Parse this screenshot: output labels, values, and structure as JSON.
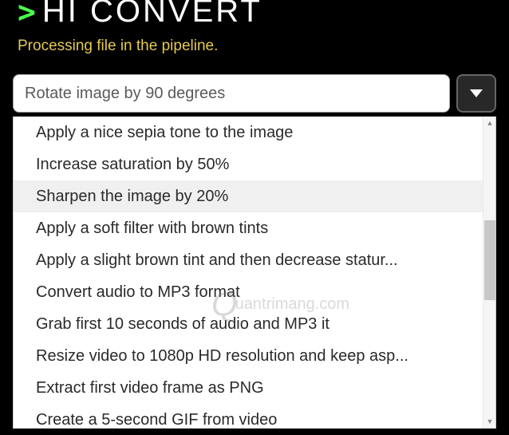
{
  "header": {
    "logo_arrow": ">",
    "logo_text": "HI CONVERT",
    "subtitle": "Processing file in the pipeline."
  },
  "select": {
    "value": "Rotate image by 90 degrees"
  },
  "dropdown": {
    "items": [
      {
        "label": "Apply a nice sepia tone to the image",
        "highlighted": false
      },
      {
        "label": "Increase saturation by 50%",
        "highlighted": false
      },
      {
        "label": "Sharpen the image by 20%",
        "highlighted": true
      },
      {
        "label": "Apply a soft filter with brown tints",
        "highlighted": false
      },
      {
        "label": "Apply a slight brown tint and then decrease statur...",
        "highlighted": false
      },
      {
        "label": "Convert audio to MP3 format",
        "highlighted": false
      },
      {
        "label": "Grab first 10 seconds of audio and MP3 it",
        "highlighted": false
      },
      {
        "label": "Resize video to 1080p HD resolution and keep asp...",
        "highlighted": false
      },
      {
        "label": "Extract first video frame as PNG",
        "highlighted": false
      },
      {
        "label": "Create a 5-second GIF from video",
        "highlighted": false
      }
    ]
  },
  "watermark": {
    "prefix": "Q",
    "text": "uantrimang.com"
  }
}
